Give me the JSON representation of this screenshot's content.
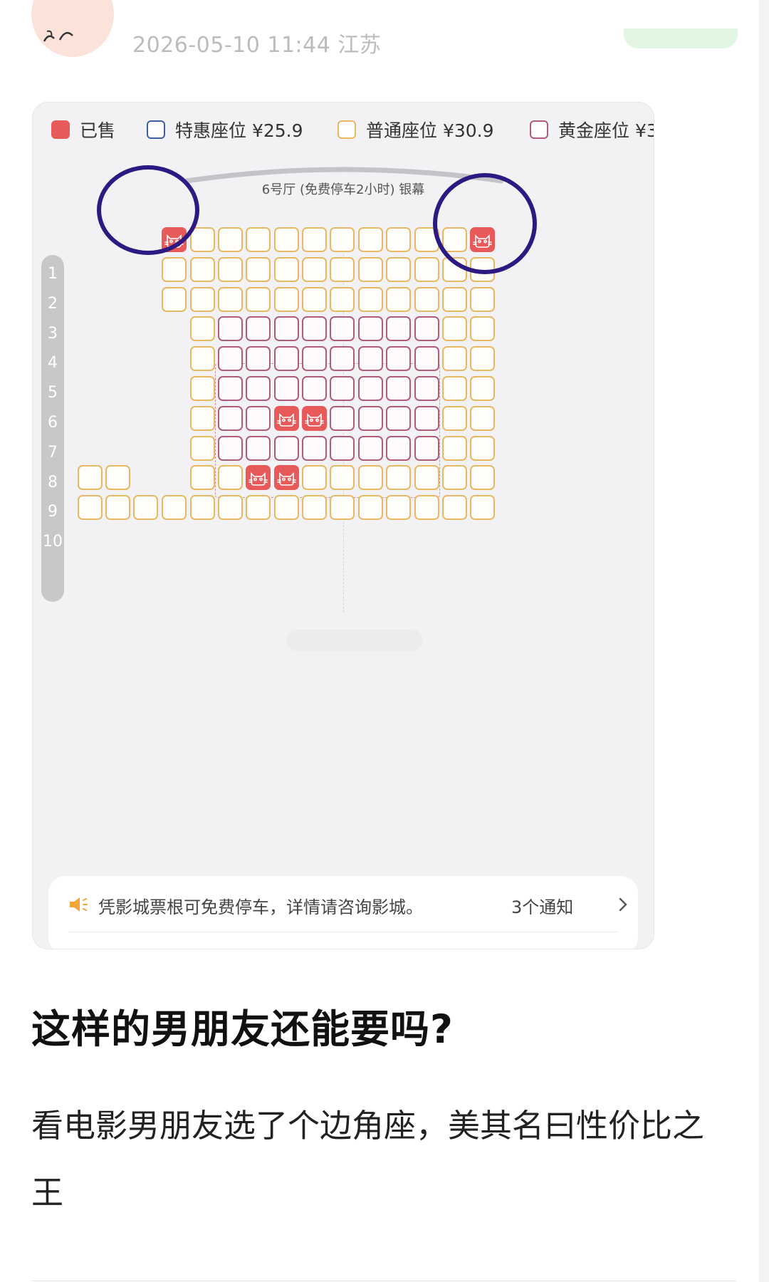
{
  "header": {
    "post_meta": "2026-05-10 11:44  江苏"
  },
  "legend": {
    "sold": "已售",
    "discount": "特惠座位 ¥25.9",
    "regular": "普通座位 ¥30.9",
    "golden": "黄金座位 ¥3"
  },
  "hall_label": "6号厅 (免费停车2小时) 银幕",
  "rows": [
    "1",
    "2",
    "3",
    "4",
    "5",
    "6",
    "7",
    "8",
    "9",
    "10"
  ],
  "notice": {
    "text": "凭影城票根可免费停车，详情请咨询影城。",
    "count": "3个通知"
  },
  "post": {
    "title": "这样的男朋友还能要吗?",
    "body": "看电影男朋友选了个边角座，美其名曰性价比之王"
  },
  "colors": {
    "sold": "#e8595a",
    "regular_border": "#e8b863",
    "golden_border": "#b25c7d",
    "discount_border": "#3d5fa8",
    "annotation_ring": "#2c1a82"
  },
  "seat_map": {
    "columns": 15,
    "rows": [
      {
        "row": "1",
        "seats": [
          "",
          "",
          "",
          "S",
          "R",
          "R",
          "R",
          "R",
          "R",
          "R",
          "R",
          "R",
          "R",
          "R",
          "S"
        ]
      },
      {
        "row": "2",
        "seats": [
          "",
          "",
          "",
          "R",
          "R",
          "R",
          "R",
          "R",
          "R",
          "R",
          "R",
          "R",
          "R",
          "R",
          "R"
        ]
      },
      {
        "row": "3",
        "seats": [
          "",
          "",
          "",
          "R",
          "R",
          "R",
          "R",
          "R",
          "R",
          "R",
          "R",
          "R",
          "R",
          "R",
          "R"
        ]
      },
      {
        "row": "4",
        "seats": [
          "",
          "",
          "",
          "",
          "",
          "R",
          "G",
          "G",
          "G",
          "G",
          "G",
          "G",
          "G",
          "G",
          "R",
          "R"
        ]
      },
      {
        "row": "5",
        "seats": [
          "",
          "",
          "",
          "",
          "",
          "R",
          "G",
          "G",
          "G",
          "G",
          "G",
          "G",
          "G",
          "G",
          "R",
          "R"
        ]
      },
      {
        "row": "6",
        "seats": [
          "",
          "",
          "",
          "",
          "",
          "R",
          "G",
          "G",
          "G",
          "G",
          "G",
          "G",
          "G",
          "G",
          "R",
          "R"
        ]
      },
      {
        "row": "7",
        "seats": [
          "",
          "",
          "",
          "",
          "",
          "R",
          "G",
          "G",
          "S",
          "S",
          "G",
          "G",
          "G",
          "G",
          "R",
          "R"
        ]
      },
      {
        "row": "8",
        "seats": [
          "",
          "",
          "",
          "",
          "",
          "R",
          "G",
          "G",
          "G",
          "G",
          "G",
          "G",
          "G",
          "G",
          "R",
          "R"
        ]
      },
      {
        "row": "9",
        "seats": [
          "",
          "R",
          "R",
          "",
          "",
          "R",
          "R",
          "S",
          "S",
          "R",
          "R",
          "R",
          "R",
          "R",
          "R",
          "R"
        ]
      },
      {
        "row": "10",
        "seats": [
          "",
          "R",
          "R",
          "R",
          "R",
          "R",
          "R",
          "R",
          "R",
          "R",
          "R",
          "R",
          "R",
          "R",
          "R",
          "R"
        ]
      }
    ]
  }
}
